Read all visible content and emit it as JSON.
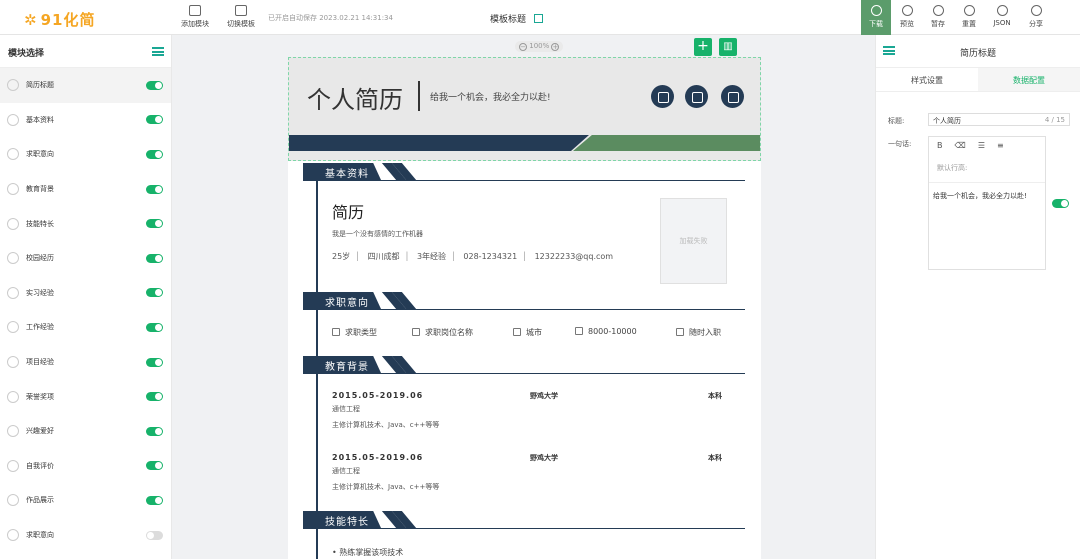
{
  "topbar": {
    "logo": "91化简",
    "add_module": "添加模块",
    "switch_template": "切换模板",
    "autosave": "已开启自动保存 2023.02.21 14:31:34",
    "template_title": "模板标题",
    "actions": [
      "下载",
      "预览",
      "暂存",
      "重置",
      "JSON",
      "分享"
    ]
  },
  "left_panel": {
    "title": "模块选择",
    "items": [
      {
        "label": "简历标题",
        "enabled": true
      },
      {
        "label": "基本资料",
        "enabled": true
      },
      {
        "label": "求职意向",
        "enabled": true
      },
      {
        "label": "教育背景",
        "enabled": true
      },
      {
        "label": "技能特长",
        "enabled": true
      },
      {
        "label": "校园经历",
        "enabled": true
      },
      {
        "label": "实习经验",
        "enabled": true
      },
      {
        "label": "工作经验",
        "enabled": true
      },
      {
        "label": "项目经验",
        "enabled": true
      },
      {
        "label": "荣誉奖项",
        "enabled": true
      },
      {
        "label": "兴趣爱好",
        "enabled": true
      },
      {
        "label": "自我评价",
        "enabled": true
      },
      {
        "label": "作品展示",
        "enabled": true
      },
      {
        "label": "求职意向",
        "enabled": false
      }
    ]
  },
  "canvas": {
    "zoom": "100%",
    "header_title": "个人简历",
    "header_subtitle": "给我一个机会，我必全力以赴!",
    "sections": [
      "基本资料",
      "求职意向",
      "教育背景",
      "技能特长"
    ],
    "basic": {
      "name": "简历",
      "intro": "我是一个没有感情的工作机器",
      "info": [
        "25岁",
        "四川成都",
        "3年经验",
        "028-1234321",
        "12322233@qq.com"
      ],
      "photo_text": "加载失败"
    },
    "intent": [
      "求职类型",
      "求职岗位名称",
      "城市",
      "8000-10000",
      "随时入职"
    ],
    "education": [
      {
        "date": "2015.05-2019.06",
        "school": "野鸡大学",
        "degree": "本科",
        "major": "通信工程",
        "courses": "主修计算机技术、Java、c++等等"
      },
      {
        "date": "2015.05-2019.06",
        "school": "野鸡大学",
        "degree": "本科",
        "major": "通信工程",
        "courses": "主修计算机技术、Java、c++等等"
      }
    ],
    "skill_first": "熟练掌握该项技术"
  },
  "right_panel": {
    "title": "简历标题",
    "tabs": [
      "样式设置",
      "数据配置"
    ],
    "title_label": "标题:",
    "title_value": "个人简历",
    "title_count": "4 / 15",
    "sentence_label": "一句话:",
    "editor_placeholder": "默认行高:",
    "editor_text": "给我一个机会，我必全力以赴!"
  }
}
